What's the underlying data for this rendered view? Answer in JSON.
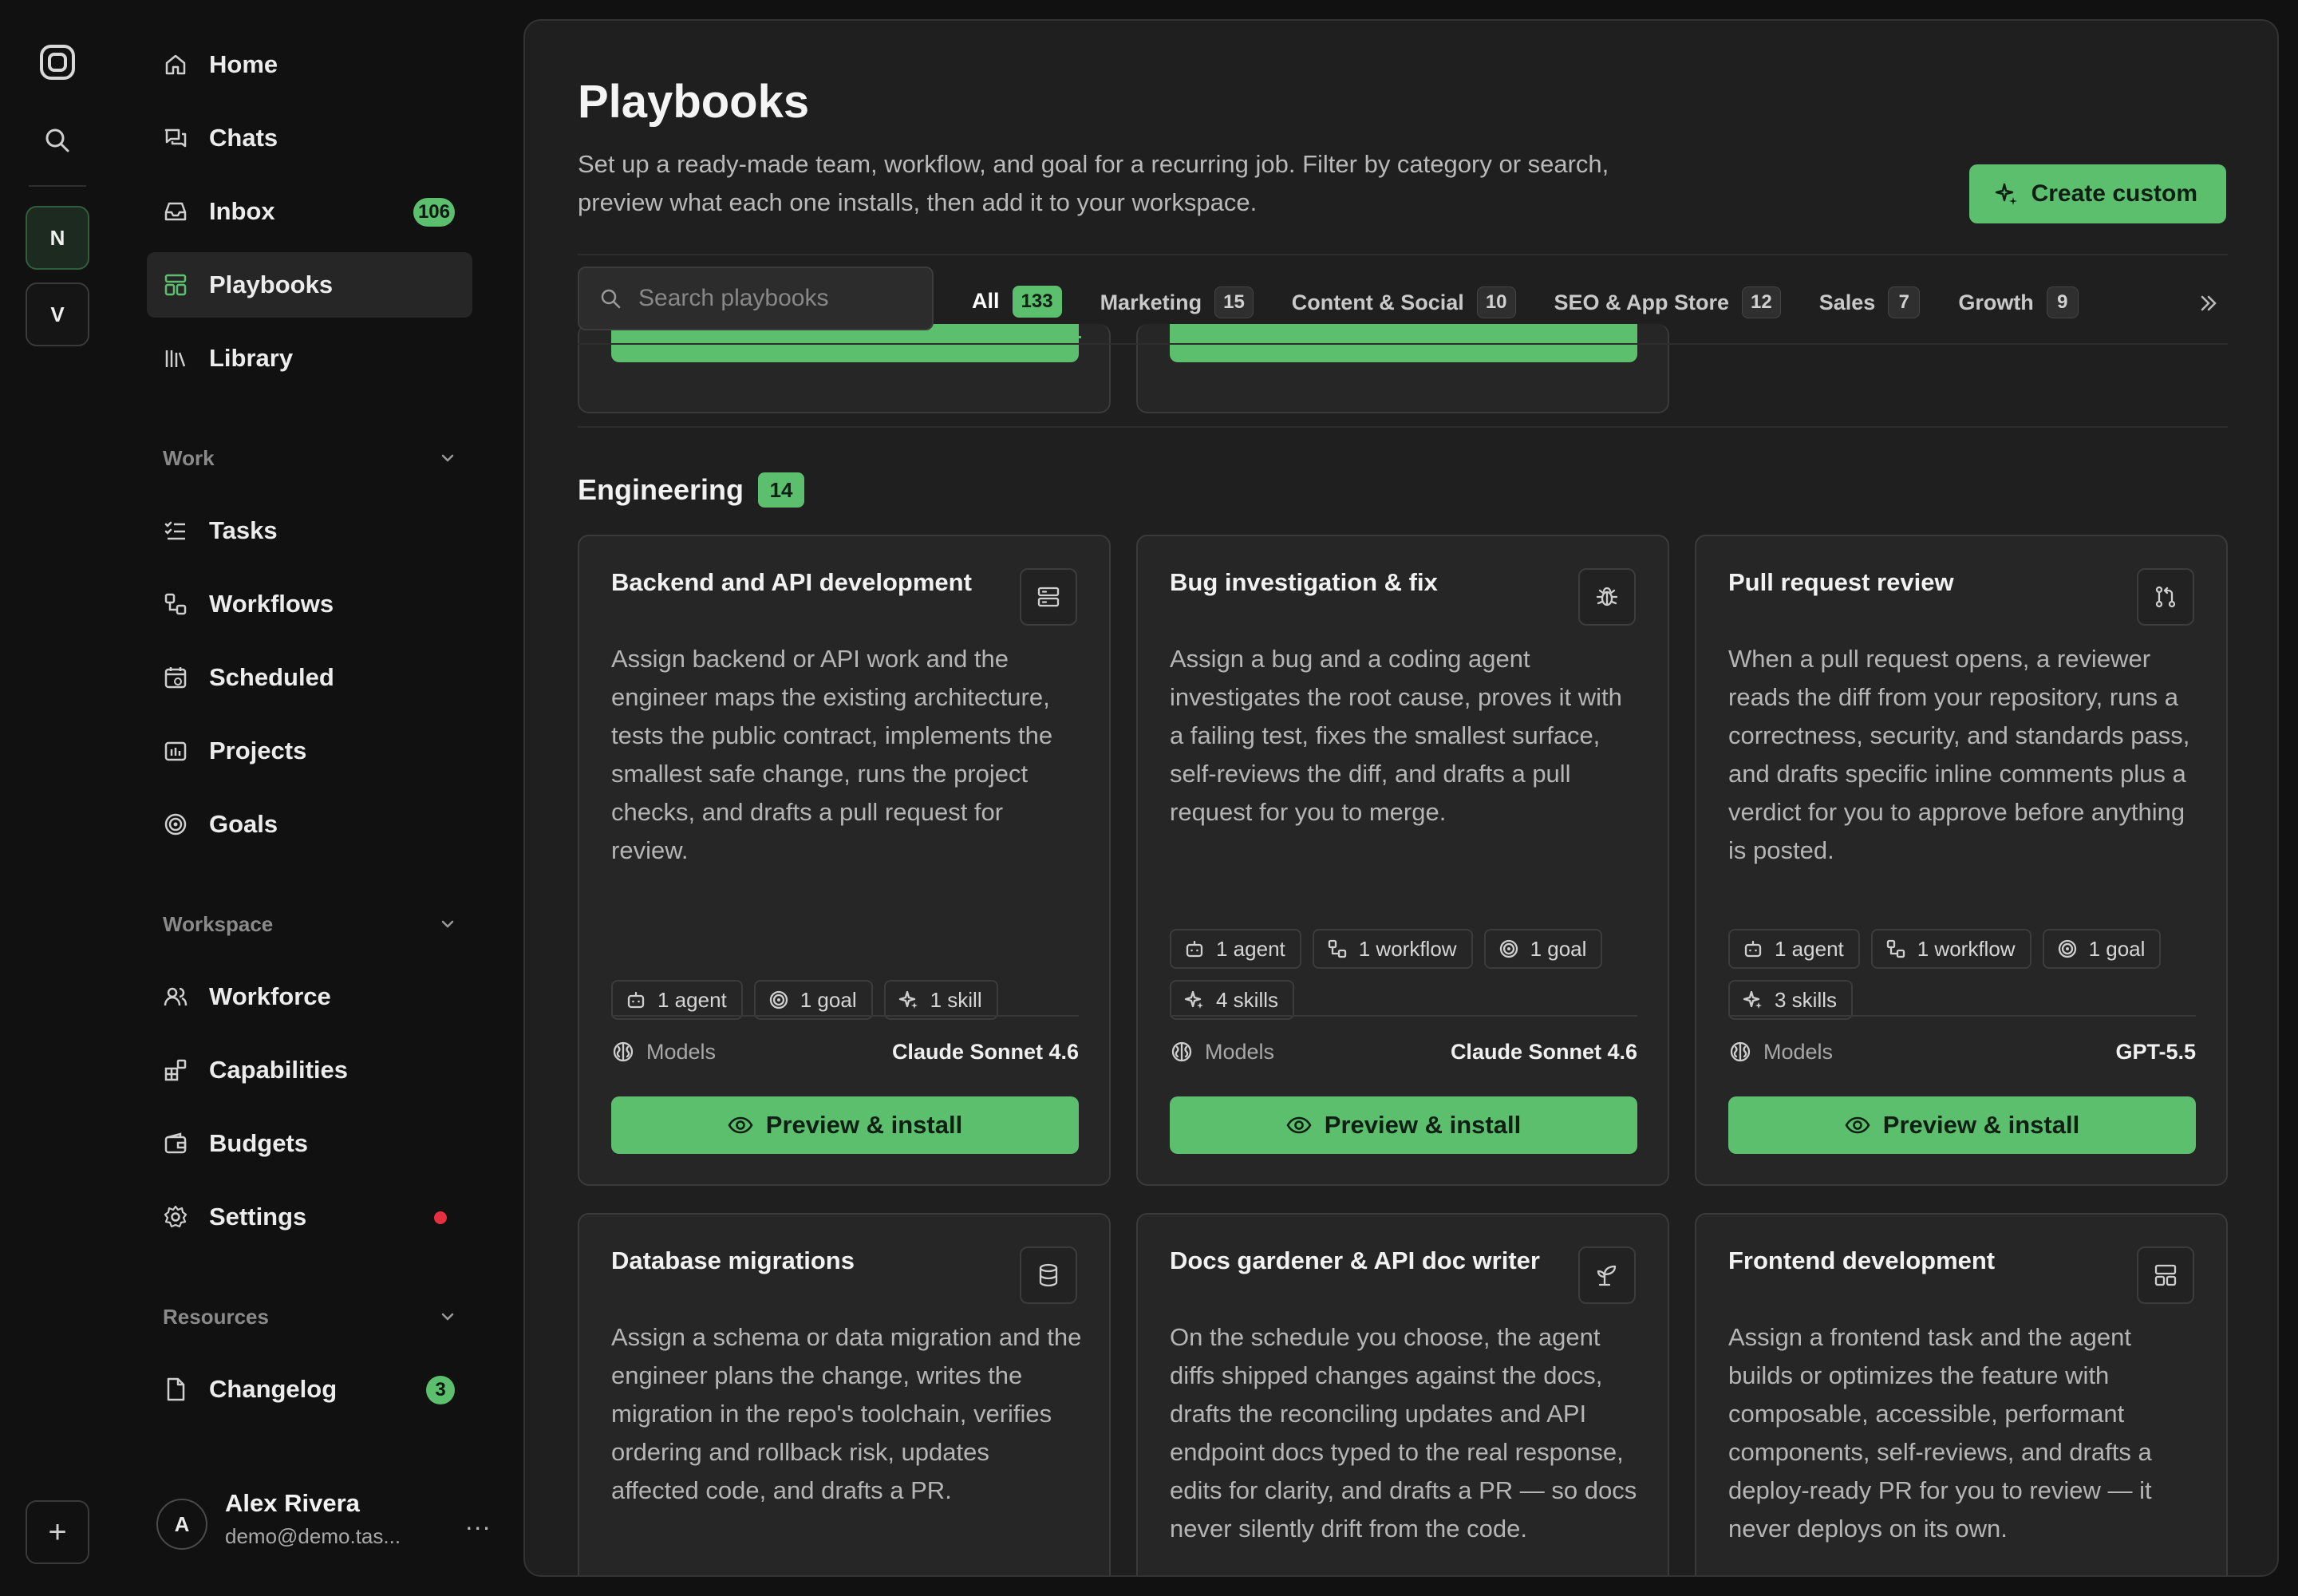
{
  "rail": {
    "workspaces": [
      "N",
      "V"
    ],
    "add_label": "+"
  },
  "sidebar": {
    "top_items": [
      {
        "label": "Home",
        "icon": "home-icon"
      },
      {
        "label": "Chats",
        "icon": "chats-icon"
      },
      {
        "label": "Inbox",
        "icon": "inbox-icon",
        "badge": "106"
      },
      {
        "label": "Playbooks",
        "icon": "playbooks-icon",
        "active": true
      },
      {
        "label": "Library",
        "icon": "library-icon"
      }
    ],
    "work": {
      "title": "Work",
      "items": [
        {
          "label": "Tasks",
          "icon": "tasks-icon"
        },
        {
          "label": "Workflows",
          "icon": "workflows-icon"
        },
        {
          "label": "Scheduled",
          "icon": "calendar-icon"
        },
        {
          "label": "Projects",
          "icon": "projects-icon"
        },
        {
          "label": "Goals",
          "icon": "target-icon"
        }
      ]
    },
    "workspace": {
      "title": "Workspace",
      "items": [
        {
          "label": "Workforce",
          "icon": "users-icon"
        },
        {
          "label": "Capabilities",
          "icon": "blocks-icon"
        },
        {
          "label": "Budgets",
          "icon": "wallet-icon"
        },
        {
          "label": "Settings",
          "icon": "gear-icon",
          "dot_color": "#e5303f"
        }
      ]
    },
    "resources": {
      "title": "Resources",
      "items": [
        {
          "label": "Changelog",
          "icon": "file-icon",
          "badge": "3"
        }
      ]
    },
    "user": {
      "initial": "A",
      "name": "Alex Rivera",
      "email": "demo@demo.tas...",
      "more": "..."
    }
  },
  "main": {
    "title": "Playbooks",
    "description": "Set up a ready-made team, workflow, and goal for a recurring job. Filter by category or search, preview what each one installs, then add it to your workspace.",
    "create_label": "Create custom",
    "search_placeholder": "Search playbooks",
    "tabs": [
      {
        "label": "All",
        "count": "133",
        "active": true
      },
      {
        "label": "Marketing",
        "count": "15"
      },
      {
        "label": "Content & Social",
        "count": "10"
      },
      {
        "label": "SEO & App Store",
        "count": "12"
      },
      {
        "label": "Sales",
        "count": "7"
      },
      {
        "label": "Growth",
        "count": "9"
      }
    ],
    "section": {
      "title": "Engineering",
      "count": "14"
    },
    "models_label": "Models",
    "install_label": "Preview & install",
    "cards": [
      {
        "title": "Backend and API development",
        "icon": "server-icon",
        "description": "Assign backend or API work and the engineer maps the existing architecture, tests the public contract, implements the smallest safe change, runs the project checks, and drafts a pull request for review.",
        "chips": [
          [
            "agent-icon",
            "1 agent"
          ],
          [
            "goal-icon",
            "1 goal"
          ],
          [
            "skill-icon",
            "1 skill"
          ]
        ],
        "model": "Claude Sonnet 4.6"
      },
      {
        "title": "Bug investigation & fix",
        "icon": "bug-icon",
        "description": "Assign a bug and a coding agent investigates the root cause, proves it with a failing test, fixes the smallest surface, self-reviews the diff, and drafts a pull request for you to merge.",
        "chips": [
          [
            "agent-icon",
            "1 agent"
          ],
          [
            "workflow-icon",
            "1 workflow"
          ],
          [
            "goal-icon",
            "1 goal"
          ],
          [
            "skill-icon",
            "4 skills"
          ]
        ],
        "model": "Claude Sonnet 4.6"
      },
      {
        "title": "Pull request review",
        "icon": "pull-request-icon",
        "description": "When a pull request opens, a reviewer reads the diff from your repository, runs a correctness, security, and standards pass, and drafts specific inline comments plus a verdict for you to approve before anything is posted.",
        "chips": [
          [
            "agent-icon",
            "1 agent"
          ],
          [
            "workflow-icon",
            "1 workflow"
          ],
          [
            "goal-icon",
            "1 goal"
          ],
          [
            "skill-icon",
            "3 skills"
          ]
        ],
        "model": "GPT-5.5"
      },
      {
        "title": "Database migrations",
        "icon": "database-icon",
        "description": "Assign a schema or data migration and the engineer plans the change, writes the migration in the repo's toolchain, verifies ordering and rollback risk, updates affected code, and drafts a PR."
      },
      {
        "title": "Docs gardener & API doc writer",
        "icon": "sprout-icon",
        "description": "On the schedule you choose, the agent diffs shipped changes against the docs, drafts the reconciling updates and API endpoint docs typed to the real response, edits for clarity, and drafts a PR — so docs never silently drift from the code."
      },
      {
        "title": "Frontend development",
        "icon": "layout-icon",
        "description": "Assign a frontend task and the agent builds or optimizes the feature with composable, accessible, performant components, self-reviews, and drafts a deploy-ready PR for you to review — it never deploys on its own."
      }
    ]
  }
}
